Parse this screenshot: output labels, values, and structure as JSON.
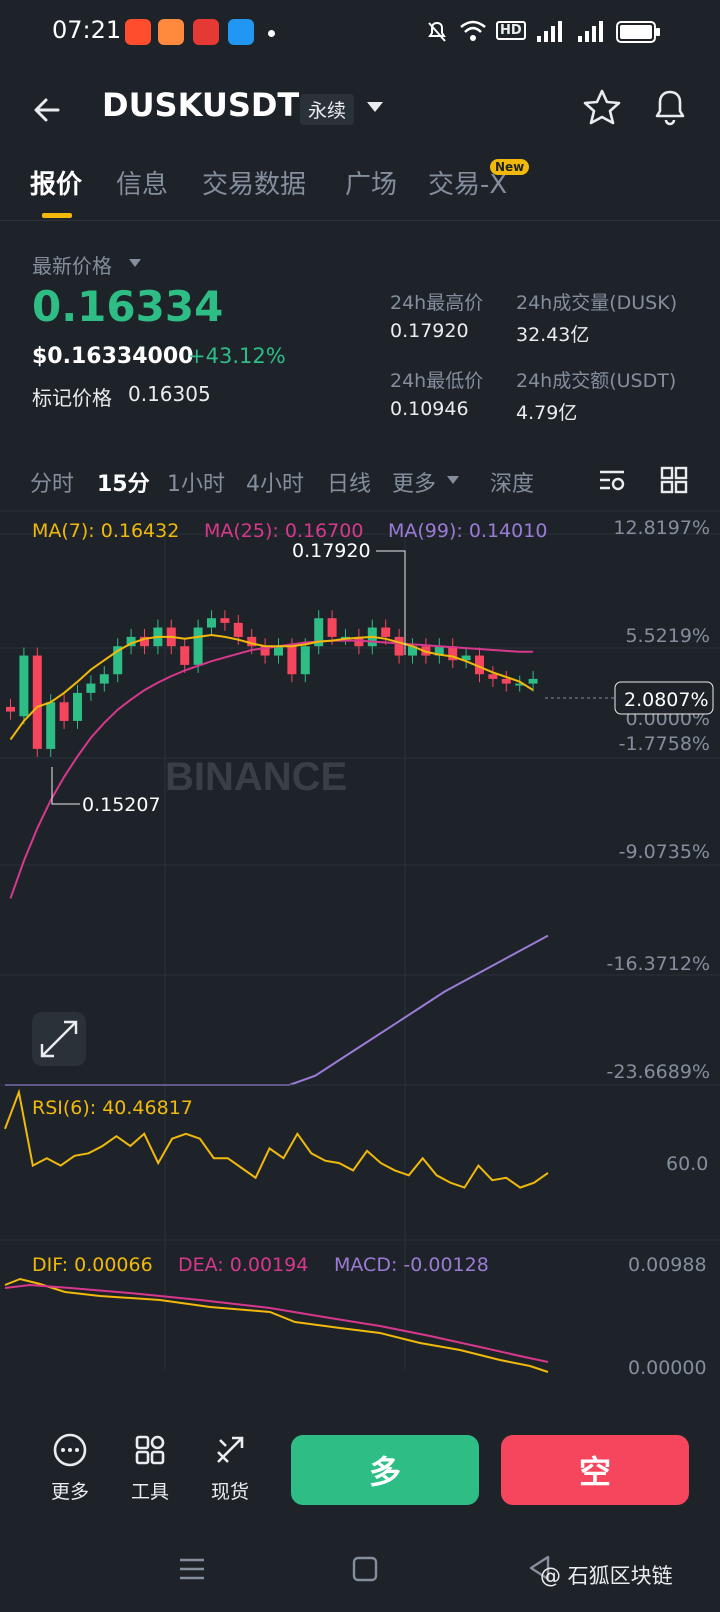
{
  "status_bar": {
    "time": "07:21",
    "indicators": [
      "mute-icon",
      "wifi-icon",
      "hd-icon",
      "signal-5g-icon",
      "signal-5g-icon",
      "battery-icon"
    ]
  },
  "header": {
    "title": "DUSKUSDT",
    "badge": "永续",
    "icons": [
      "back-arrow-icon",
      "star-icon",
      "bell-icon"
    ]
  },
  "tabs": [
    {
      "label": "报价",
      "active": true
    },
    {
      "label": "信息"
    },
    {
      "label": "交易数据"
    },
    {
      "label": "广场"
    },
    {
      "label": "交易-X",
      "badge": "New"
    }
  ],
  "price": {
    "label": "最新价格",
    "last": "0.16334",
    "usd": "$0.16334000",
    "change": "+43.12%",
    "mark_label": "标记价格",
    "mark_value": "0.16305",
    "up_color": "#2ebd85",
    "down_color": "#f6465d"
  },
  "stats": {
    "high_label": "24h最高价",
    "high": "0.17920",
    "vol_label": "24h成交量(DUSK)",
    "vol": "32.43亿",
    "low_label": "24h最低价",
    "low": "0.10946",
    "amt_label": "24h成交额(USDT)",
    "amt": "4.79亿"
  },
  "intervals": [
    {
      "label": "分时"
    },
    {
      "label": "15分",
      "active": true
    },
    {
      "label": "1小时"
    },
    {
      "label": "4小时"
    },
    {
      "label": "日线"
    },
    {
      "label": "更多"
    },
    {
      "label": "深度"
    }
  ],
  "ma_legend": {
    "ma7": "MA(7): 0.16432",
    "ma25": "MA(25): 0.16700",
    "ma99": "MA(99): 0.14010"
  },
  "chart_data": {
    "type": "candlestick",
    "watermark": "BINANCE",
    "y_axis_percent": [
      "12.8197%",
      "5.5219%",
      "0.0000%",
      "-1.7758%",
      "-9.0735%",
      "-16.3712%",
      "-23.6689%"
    ],
    "current_change": "2.0807%",
    "high_label": "0.17920",
    "low_label": "0.15207",
    "candles_oc": [
      [
        0.1625,
        0.162
      ],
      [
        0.1615,
        0.168
      ],
      [
        0.168,
        0.158
      ],
      [
        0.158,
        0.163
      ],
      [
        0.163,
        0.161
      ],
      [
        0.161,
        0.164
      ],
      [
        0.164,
        0.165
      ],
      [
        0.165,
        0.166
      ],
      [
        0.166,
        0.169
      ],
      [
        0.169,
        0.17
      ],
      [
        0.17,
        0.169
      ],
      [
        0.169,
        0.171
      ],
      [
        0.171,
        0.169
      ],
      [
        0.169,
        0.167
      ],
      [
        0.167,
        0.171
      ],
      [
        0.171,
        0.172
      ],
      [
        0.172,
        0.1715
      ],
      [
        0.1715,
        0.17
      ],
      [
        0.17,
        0.169
      ],
      [
        0.169,
        0.168
      ],
      [
        0.168,
        0.169
      ],
      [
        0.169,
        0.166
      ],
      [
        0.166,
        0.169
      ],
      [
        0.169,
        0.172
      ],
      [
        0.172,
        0.17
      ],
      [
        0.17,
        0.17
      ],
      [
        0.17,
        0.169
      ],
      [
        0.169,
        0.171
      ],
      [
        0.171,
        0.17
      ],
      [
        0.17,
        0.168
      ],
      [
        0.168,
        0.169
      ],
      [
        0.169,
        0.168
      ],
      [
        0.168,
        0.169
      ],
      [
        0.169,
        0.1675
      ],
      [
        0.1675,
        0.168
      ],
      [
        0.168,
        0.166
      ],
      [
        0.166,
        0.1655
      ],
      [
        0.1655,
        0.165
      ],
      [
        0.165,
        0.165
      ],
      [
        0.165,
        0.1655
      ]
    ],
    "ma7_series": [
      0.159,
      0.161,
      0.1625,
      0.163,
      0.164,
      0.1652,
      0.1665,
      0.1675,
      0.1685,
      0.1693,
      0.1698,
      0.17,
      0.17,
      0.1698,
      0.17,
      0.1702,
      0.17,
      0.1697,
      0.1693,
      0.169,
      0.169,
      0.169,
      0.1692,
      0.1695,
      0.1696,
      0.1698,
      0.1699,
      0.17,
      0.1698,
      0.1694,
      0.169,
      0.1684,
      0.1681,
      0.1679,
      0.1674,
      0.1668,
      0.1662,
      0.1657,
      0.1652,
      0.1643
    ],
    "ma25_series": [
      0.142,
      0.146,
      0.1495,
      0.1525,
      0.155,
      0.1572,
      0.1592,
      0.1608,
      0.1622,
      0.1633,
      0.1643,
      0.1651,
      0.1658,
      0.1664,
      0.1669,
      0.1674,
      0.1678,
      0.1682,
      0.1686,
      0.1688,
      0.169,
      0.1692,
      0.1694,
      0.1695,
      0.1696,
      0.1696,
      0.1696,
      0.1695,
      0.1694,
      0.1693,
      0.1692,
      0.1691,
      0.169,
      0.1689,
      0.1688,
      0.1687,
      0.1686,
      0.1685,
      0.1684,
      0.1684
    ],
    "ma99_series": [
      0.102,
      0.1035,
      0.105,
      0.1068,
      0.1086,
      0.1104,
      0.1122,
      0.114,
      0.1158,
      0.1176,
      0.1194,
      0.1212,
      0.123,
      0.1248,
      0.1266,
      0.1284,
      0.1302,
      0.132,
      0.1335,
      0.135,
      0.1365,
      0.138
    ],
    "rsi": {
      "label": "RSI(6): 40.46817",
      "axis_label": "60.0",
      "series": [
        55,
        70,
        40,
        43,
        40,
        44,
        45,
        48,
        52,
        48,
        53,
        41,
        51,
        53,
        51,
        43,
        43,
        39,
        35,
        47,
        43,
        53,
        45,
        42,
        41,
        38,
        46,
        41,
        38,
        36,
        43,
        36,
        33,
        31,
        40,
        34,
        35,
        31,
        33,
        37
      ]
    },
    "macd": {
      "dif_label": "DIF: 0.00066",
      "dea_label": "DEA: 0.00194",
      "macd_label": "MACD: -0.00128",
      "axis_top": "0.00988",
      "axis_bottom": "0.00000"
    }
  },
  "bottom_bar": {
    "more": "更多",
    "tools": "工具",
    "spot": "现货",
    "long": "多",
    "short": "空"
  },
  "watermark_text": "@ 石狐区块链"
}
